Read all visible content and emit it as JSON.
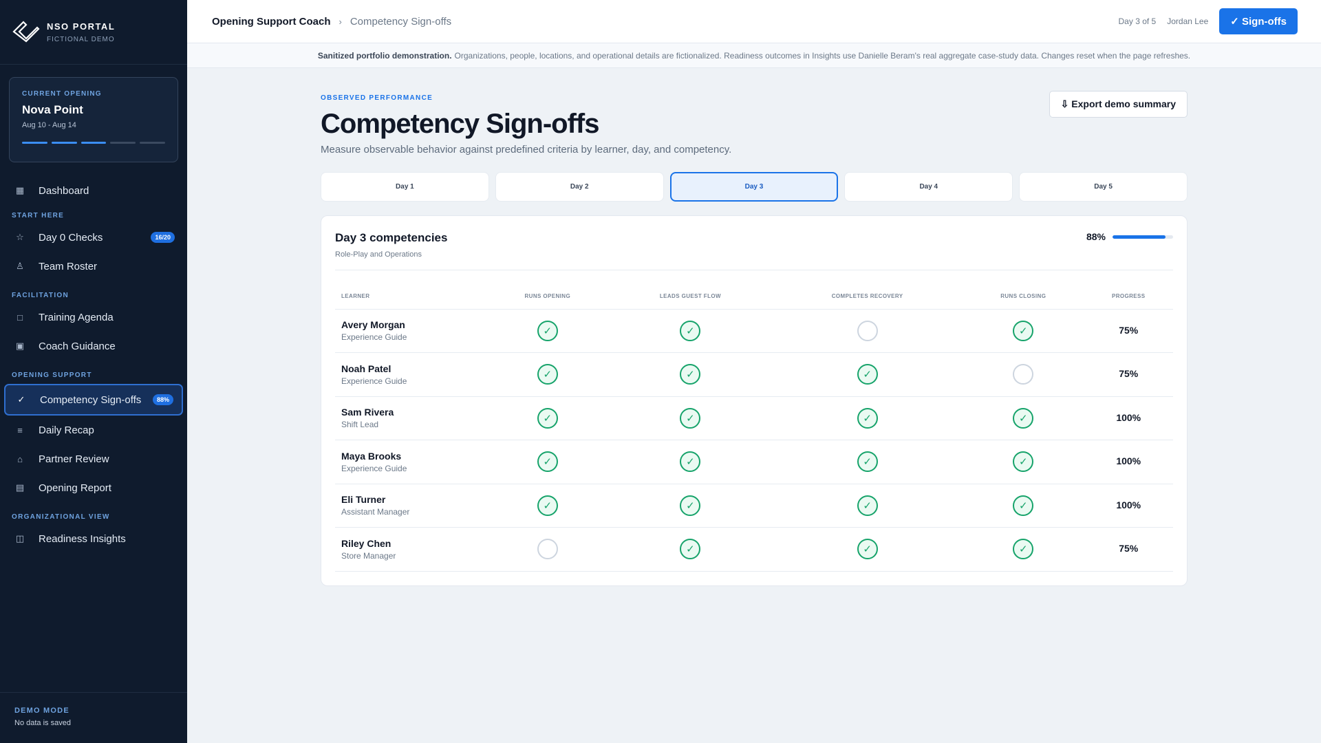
{
  "brand": {
    "title": "NSO PORTAL",
    "subtitle": "FICTIONAL DEMO"
  },
  "opening": {
    "label": "CURRENT OPENING",
    "name": "Nova Point",
    "dates": "Aug 10 - Aug 14",
    "days_complete": 3,
    "days_total": 5
  },
  "nav": {
    "dashboard": {
      "label": "Dashboard",
      "icon": "grid-icon"
    },
    "sections": {
      "start_here": "START HERE",
      "facilitation": "FACILITATION",
      "opening_support": "OPENING SUPPORT",
      "organizational_view": "ORGANIZATIONAL VIEW"
    },
    "day0": {
      "label": "Day 0 Checks",
      "badge": "16/20",
      "icon": "star-icon"
    },
    "roster": {
      "label": "Team Roster",
      "icon": "person-icon"
    },
    "agenda": {
      "label": "Training Agenda",
      "icon": "square-icon"
    },
    "guidance": {
      "label": "Coach Guidance",
      "icon": "filled-square-icon"
    },
    "signoffs": {
      "label": "Competency Sign-offs",
      "badge": "88%",
      "icon": "check-icon"
    },
    "recap": {
      "label": "Daily Recap",
      "icon": "lines-icon"
    },
    "partner": {
      "label": "Partner Review",
      "icon": "home-icon"
    },
    "report": {
      "label": "Opening Report",
      "icon": "document-icon"
    },
    "insights": {
      "label": "Readiness Insights",
      "icon": "columns-icon"
    }
  },
  "demo": {
    "title": "DEMO MODE",
    "subtitle": "No data is saved"
  },
  "topbar": {
    "crumb_root": "Opening Support Coach",
    "crumb_sep": "›",
    "crumb_current": "Competency Sign-offs",
    "day_of": "Day 3 of 5",
    "user": "Jordan Lee",
    "primary_button": "✓ Sign-offs"
  },
  "notice": {
    "bold": "Sanitized portfolio demonstration.",
    "text": "Organizations, people, locations, and operational details are fictionalized. Readiness outcomes in Insights use Danielle Beram's real aggregate case-study data. Changes reset when the page refreshes."
  },
  "page": {
    "eyebrow": "OBSERVED PERFORMANCE",
    "title": "Competency Sign-offs",
    "description": "Measure observable behavior against predefined criteria by learner, day, and competency.",
    "export_button": "⇩ Export demo summary"
  },
  "day_tabs": [
    "Day 1",
    "Day 2",
    "Day 3",
    "Day 4",
    "Day 5"
  ],
  "active_day_index": 2,
  "panel": {
    "title": "Day 3 competencies",
    "subtitle": "Role-Play and Operations",
    "progress_label": "88%",
    "progress_value": 0.88
  },
  "table": {
    "headers": [
      "LEARNER",
      "RUNS OPENING",
      "LEADS GUEST FLOW",
      "COMPLETES RECOVERY",
      "RUNS CLOSING",
      "PROGRESS"
    ],
    "rows": [
      {
        "name": "Avery Morgan",
        "role": "Experience Guide",
        "checks": [
          true,
          true,
          false,
          true
        ],
        "progress": "75%"
      },
      {
        "name": "Noah Patel",
        "role": "Experience Guide",
        "checks": [
          true,
          true,
          true,
          false
        ],
        "progress": "75%"
      },
      {
        "name": "Sam Rivera",
        "role": "Shift Lead",
        "checks": [
          true,
          true,
          true,
          true
        ],
        "progress": "100%"
      },
      {
        "name": "Maya Brooks",
        "role": "Experience Guide",
        "checks": [
          true,
          true,
          true,
          true
        ],
        "progress": "100%"
      },
      {
        "name": "Eli Turner",
        "role": "Assistant Manager",
        "checks": [
          true,
          true,
          true,
          true
        ],
        "progress": "100%"
      },
      {
        "name": "Riley Chen",
        "role": "Store Manager",
        "checks": [
          false,
          true,
          true,
          true
        ],
        "progress": "75%"
      }
    ]
  },
  "colors": {
    "sidebar_bg": "#0f1b2d",
    "accent": "#1a73e8",
    "check_green": "#16a36a",
    "page_bg": "#eef2f6"
  }
}
